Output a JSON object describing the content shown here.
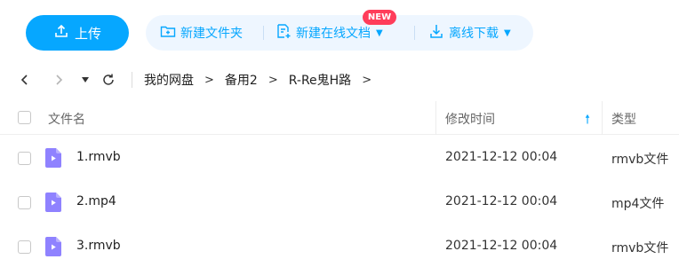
{
  "toolbar": {
    "upload_label": "上传",
    "new_folder_label": "新建文件夹",
    "new_online_doc_label": "新建在线文档",
    "new_badge": "NEW",
    "offline_download_label": "离线下载"
  },
  "nav": {
    "breadcrumbs": [
      "我的网盘",
      "备用2",
      "R-Re鬼H路"
    ]
  },
  "table": {
    "headers": {
      "name": "文件名",
      "modified": "修改时间",
      "type": "类型"
    },
    "rows": [
      {
        "name": "1.rmvb",
        "modified": "2021-12-12 00:04",
        "type": "rmvb文件"
      },
      {
        "name": "2.mp4",
        "modified": "2021-12-12 00:04",
        "type": "mp4文件"
      },
      {
        "name": "3.rmvb",
        "modified": "2021-12-12 00:04",
        "type": "rmvb文件"
      }
    ]
  },
  "colors": {
    "accent": "#06a7ff",
    "badge": "#ff3d5a",
    "video_icon": "#8f82ff"
  }
}
